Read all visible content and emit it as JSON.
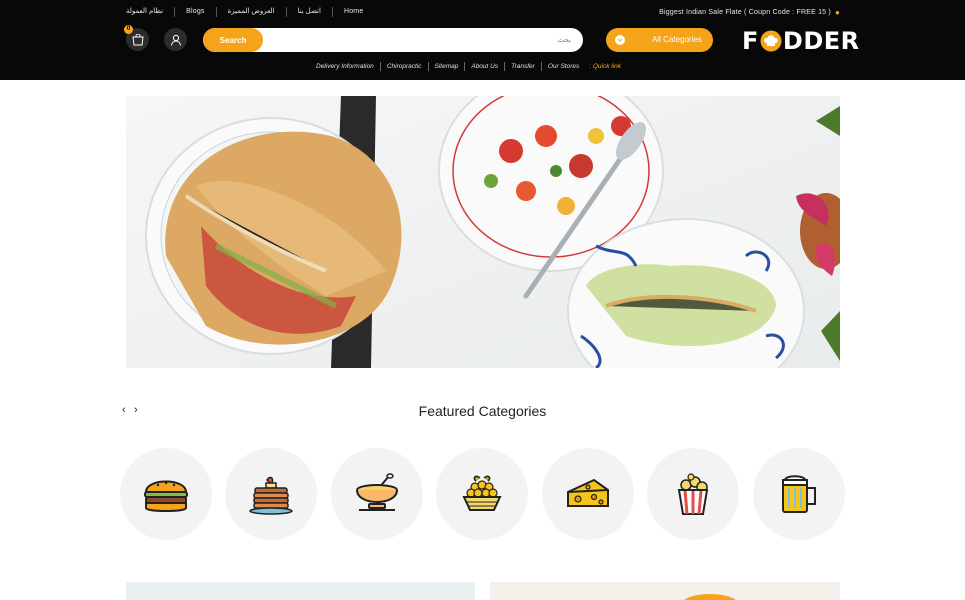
{
  "top_nav": {
    "links": [
      "نظام العمولة",
      "Blogs",
      "العروض المميزة",
      "اتصل بنا",
      "Home"
    ]
  },
  "promo": {
    "text": "Biggest Indian Sale Flate ( Coupn Code : FREE 15 )",
    "icon": "tag-icon"
  },
  "header": {
    "cart_count": "0",
    "search_button": "Search",
    "search_placeholder": "بحث",
    "category_button": "All Categories",
    "logo_prefix": "F",
    "logo_suffix": "DDER"
  },
  "quick_links": {
    "items": [
      "Delivery Information",
      "Chiropractic",
      "Sitemap",
      "About Us",
      "Transfer",
      "Our Stores"
    ],
    "title": ": Quick link"
  },
  "banner": {
    "image": "food-banner-tacos-salad"
  },
  "featured": {
    "title": "Featured Categories",
    "prev": "‹",
    "next": "›",
    "categories": [
      "burger-icon",
      "pancake-icon",
      "soup-bowl-icon",
      "fruit-bowl-icon",
      "cheese-icon",
      "popcorn-icon",
      "beer-mug-icon"
    ]
  },
  "colors": {
    "accent": "#f5a31a",
    "header_bg": "#080808",
    "circle_bg": "#f3f3f3"
  }
}
